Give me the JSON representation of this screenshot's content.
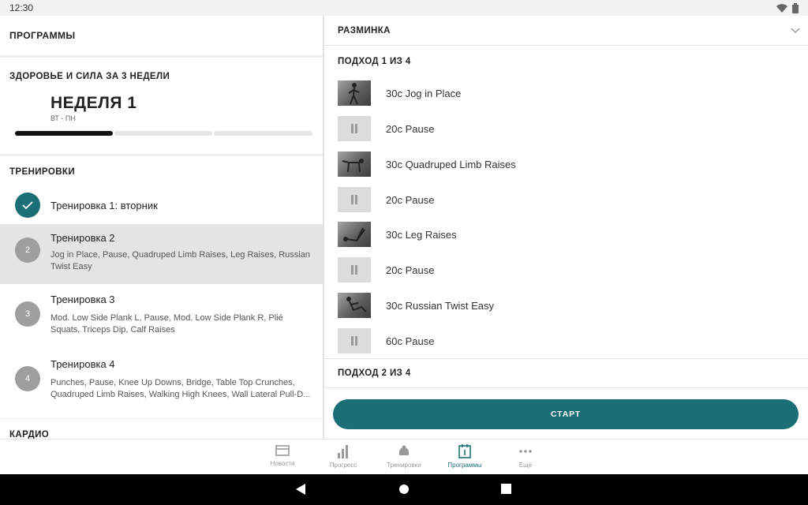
{
  "status_bar": {
    "time": "12:30"
  },
  "left_panel": {
    "header": "ПРОГРАММЫ",
    "plan": {
      "title": "ЗДОРОВЬЕ И СИЛА ЗА 3 НЕДЕЛИ",
      "week": "НЕДЕЛЯ 1",
      "days": "ВТ - ПН",
      "week_progress": 1
    },
    "workouts_title": "ТРЕНИРОВКИ",
    "workouts": [
      {
        "badge": "",
        "title": "Тренировка 1: вторник",
        "description": "",
        "done": true
      },
      {
        "badge": "2",
        "title": "Тренировка 2",
        "description": "Jog in Place, Pause, Quadruped Limb Raises, Leg Raises, Russian Twist Easy",
        "selected": true
      },
      {
        "badge": "3",
        "title": "Тренировка 3",
        "description": "Mod. Low Side Plank L, Pause, Mod. Low Side Plank R, Plié Squats, Triceps Dip, Calf Raises"
      },
      {
        "badge": "4",
        "title": "Тренировка 4",
        "description": "Punches, Pause, Knee Up Downs, Bridge, Table Top Crunches, Quadruped Limb Raises, Walking High Knees, Wall Lateral Pull-D..."
      }
    ],
    "cardio_title": "КАРДИО"
  },
  "right_panel": {
    "warmup_label": "РАЗМИНКА",
    "set1_title": "ПОДХОД 1 ИЗ 4",
    "exercises": [
      {
        "label": "30с Jog in Place",
        "icon": "jog-photo"
      },
      {
        "label": "20с Pause",
        "icon": "pause-icon"
      },
      {
        "label": "30с Quadruped Limb Raises",
        "icon": "quadruped-photo"
      },
      {
        "label": "20с Pause",
        "icon": "pause-icon"
      },
      {
        "label": "30с Leg Raises",
        "icon": "leg-raises-photo"
      },
      {
        "label": "20с Pause",
        "icon": "pause-icon"
      },
      {
        "label": "30с Russian Twist Easy",
        "icon": "russian-twist-photo"
      },
      {
        "label": "60с Pause",
        "icon": "pause-icon"
      }
    ],
    "set2_title": "ПОДХОД 2 ИЗ 4",
    "start_label": "СТАРТ"
  },
  "bottom_nav": {
    "items": [
      {
        "label": "Новости",
        "icon": "news-icon"
      },
      {
        "label": "Прогресс",
        "icon": "progress-icon"
      },
      {
        "label": "Тренировки",
        "icon": "workouts-icon"
      },
      {
        "label": "Программы",
        "icon": "programs-icon",
        "active": true
      },
      {
        "label": "Ещё",
        "icon": "more-icon"
      }
    ]
  },
  "colors": {
    "accent": "#1a6f76",
    "inactive": "#9e9e9e"
  }
}
